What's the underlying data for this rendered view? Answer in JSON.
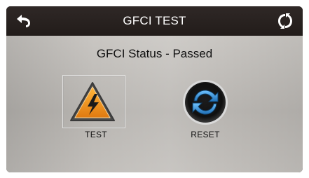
{
  "header": {
    "title": "GFCI TEST",
    "back_icon": "back-arrow-icon",
    "refresh_icon": "refresh-icon"
  },
  "main": {
    "status_text": "GFCI Status - Passed",
    "buttons": [
      {
        "label": "TEST",
        "icon": "warning-lightning-icon",
        "color": "#f39a1a"
      },
      {
        "label": "RESET",
        "icon": "reset-cycle-icon",
        "color": "#2f86c8"
      }
    ]
  }
}
